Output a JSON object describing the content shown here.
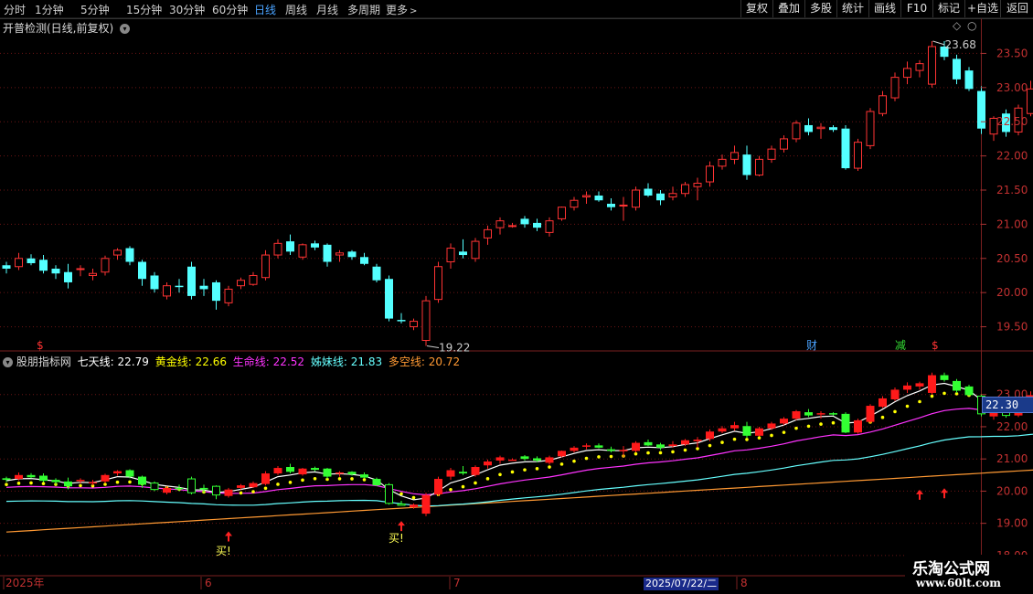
{
  "toolbar": {
    "periods": [
      "分时",
      "1分钟",
      "5分钟",
      "15分钟",
      "30分钟",
      "60分钟",
      "日线",
      "周线",
      "月线",
      "多周期",
      "更多"
    ],
    "active_period": "日线",
    "more_chevron_icon": "chevron-right-icon",
    "right_buttons": [
      "复权",
      "叠加",
      "多股",
      "统计",
      "画线",
      "F10",
      "标记",
      "+自选",
      "返回"
    ]
  },
  "main_panel": {
    "title": "开普检测(日线,前复权)",
    "dropdown_icon": "chevron-down-circle-icon",
    "corner_icon": "diamond-icon",
    "marks": {
      "s1": "$",
      "cai": "财",
      "jian": "减",
      "s2": "$"
    }
  },
  "indicator_panel": {
    "name": "股朋指标网",
    "lines": [
      {
        "label": "七天线:",
        "value": "22.79",
        "color": "#ffffff"
      },
      {
        "label": "黄金线:",
        "value": "22.66",
        "color": "#ffff00"
      },
      {
        "label": "生命线:",
        "value": "22.52",
        "color": "#ff33ff"
      },
      {
        "label": "姊妹线:",
        "value": "21.83",
        "color": "#66ffff"
      },
      {
        "label": "多空线:",
        "value": "20.72",
        "color": "#ff9933"
      }
    ],
    "buy_label": "买!",
    "current_value": "22.30"
  },
  "x_axis": {
    "labels": [
      "2025年",
      "6",
      "7",
      "8"
    ],
    "cursor_date": "2025/07/22/二"
  },
  "watermark": {
    "title": "乐淘公式网",
    "url": "www.60lt.com"
  },
  "chart_data": [
    {
      "type": "candlestick",
      "title": "开普检测(日线,前复权)",
      "ylim": [
        19.2,
        23.8
      ],
      "yticks": [
        19.5,
        20.0,
        20.5,
        21.0,
        21.5,
        22.0,
        22.5,
        23.0,
        23.5
      ],
      "annotations": {
        "high": "23.68",
        "low": "19.22"
      },
      "ohlc": [
        [
          20.4,
          20.45,
          20.28,
          20.35
        ],
        [
          20.38,
          20.58,
          20.33,
          20.5
        ],
        [
          20.5,
          20.56,
          20.4,
          20.43
        ],
        [
          20.48,
          20.55,
          20.28,
          20.32
        ],
        [
          20.35,
          20.4,
          20.2,
          20.28
        ],
        [
          20.3,
          20.42,
          20.06,
          20.15
        ],
        [
          20.35,
          20.4,
          20.24,
          20.35
        ],
        [
          20.25,
          20.35,
          20.18,
          20.28
        ],
        [
          20.3,
          20.54,
          20.25,
          20.5
        ],
        [
          20.55,
          20.65,
          20.48,
          20.62
        ],
        [
          20.65,
          20.68,
          20.4,
          20.45
        ],
        [
          20.45,
          20.48,
          20.1,
          20.2
        ],
        [
          20.25,
          20.3,
          20.0,
          20.05
        ],
        [
          19.95,
          20.15,
          19.9,
          20.1
        ],
        [
          20.1,
          20.2,
          20.0,
          20.08
        ],
        [
          20.38,
          20.45,
          19.9,
          19.95
        ],
        [
          20.1,
          20.2,
          19.95,
          20.05
        ],
        [
          20.15,
          20.18,
          19.75,
          19.88
        ],
        [
          19.85,
          20.1,
          19.8,
          20.05
        ],
        [
          20.1,
          20.22,
          20.05,
          20.18
        ],
        [
          20.12,
          20.3,
          20.1,
          20.25
        ],
        [
          20.22,
          20.62,
          20.18,
          20.55
        ],
        [
          20.55,
          20.78,
          20.5,
          20.72
        ],
        [
          20.75,
          20.85,
          20.55,
          20.6
        ],
        [
          20.52,
          20.72,
          20.48,
          20.7
        ],
        [
          20.72,
          20.76,
          20.62,
          20.66
        ],
        [
          20.7,
          20.72,
          20.38,
          20.45
        ],
        [
          20.55,
          20.62,
          20.45,
          20.58
        ],
        [
          20.6,
          20.62,
          20.48,
          20.52
        ],
        [
          20.52,
          20.58,
          20.4,
          20.42
        ],
        [
          20.38,
          20.42,
          20.15,
          20.18
        ],
        [
          20.2,
          20.25,
          19.58,
          19.62
        ],
        [
          19.6,
          19.7,
          19.55,
          19.58
        ],
        [
          19.5,
          19.62,
          19.45,
          19.58
        ],
        [
          19.3,
          19.95,
          19.22,
          19.88
        ],
        [
          19.9,
          20.45,
          19.85,
          20.38
        ],
        [
          20.45,
          20.72,
          20.35,
          20.65
        ],
        [
          20.6,
          20.78,
          20.5,
          20.55
        ],
        [
          20.5,
          20.8,
          20.45,
          20.75
        ],
        [
          20.8,
          20.98,
          20.7,
          20.92
        ],
        [
          20.95,
          21.1,
          20.85,
          21.05
        ],
        [
          20.98,
          21.02,
          20.95,
          20.98
        ],
        [
          21.08,
          21.12,
          20.95,
          21.0
        ],
        [
          21.02,
          21.08,
          20.9,
          20.95
        ],
        [
          20.88,
          21.1,
          20.82,
          21.05
        ],
        [
          21.08,
          21.26,
          21.05,
          21.25
        ],
        [
          21.25,
          21.4,
          21.2,
          21.35
        ],
        [
          21.4,
          21.48,
          21.3,
          21.42
        ],
        [
          21.42,
          21.48,
          21.33,
          21.35
        ],
        [
          21.3,
          21.38,
          21.2,
          21.25
        ],
        [
          21.28,
          21.4,
          21.05,
          21.28
        ],
        [
          21.25,
          21.55,
          21.2,
          21.5
        ],
        [
          21.52,
          21.6,
          21.4,
          21.42
        ],
        [
          21.45,
          21.5,
          21.28,
          21.35
        ],
        [
          21.4,
          21.55,
          21.35,
          21.45
        ],
        [
          21.45,
          21.62,
          21.4,
          21.58
        ],
        [
          21.55,
          21.68,
          21.35,
          21.6
        ],
        [
          21.62,
          21.92,
          21.55,
          21.85
        ],
        [
          21.85,
          22.02,
          21.8,
          21.95
        ],
        [
          21.95,
          22.15,
          21.88,
          22.05
        ],
        [
          22.02,
          22.15,
          21.65,
          21.72
        ],
        [
          21.72,
          22.0,
          21.7,
          21.95
        ],
        [
          21.95,
          22.15,
          21.9,
          22.1
        ],
        [
          22.1,
          22.3,
          22.05,
          22.25
        ],
        [
          22.25,
          22.52,
          22.2,
          22.48
        ],
        [
          22.45,
          22.55,
          22.3,
          22.35
        ],
        [
          22.4,
          22.48,
          22.25,
          22.42
        ],
        [
          22.42,
          22.45,
          22.35,
          22.38
        ],
        [
          22.4,
          22.45,
          21.8,
          21.82
        ],
        [
          21.82,
          22.25,
          21.78,
          22.2
        ],
        [
          22.15,
          22.7,
          22.1,
          22.65
        ],
        [
          22.62,
          22.95,
          22.58,
          22.88
        ],
        [
          22.85,
          23.22,
          22.8,
          23.15
        ],
        [
          23.15,
          23.38,
          23.05,
          23.28
        ],
        [
          23.25,
          23.4,
          23.15,
          23.35
        ],
        [
          23.05,
          23.68,
          23.0,
          23.6
        ],
        [
          23.6,
          23.68,
          23.4,
          23.45
        ],
        [
          23.42,
          23.48,
          23.05,
          23.12
        ],
        [
          23.25,
          23.3,
          22.95,
          22.98
        ],
        [
          22.95,
          23.02,
          22.32,
          22.4
        ],
        [
          22.32,
          22.58,
          22.22,
          22.55
        ],
        [
          22.62,
          22.68,
          22.28,
          22.35
        ],
        [
          22.35,
          22.75,
          22.3,
          22.7
        ],
        [
          22.62,
          23.1,
          22.58,
          22.98
        ],
        [
          22.98,
          23.12,
          22.92,
          22.95
        ],
        [
          22.8,
          22.9,
          22.42,
          22.55
        ],
        [
          22.95,
          22.98,
          22.92,
          22.95
        ]
      ]
    },
    {
      "type": "line",
      "title": "股朋指标网",
      "ylim": [
        17.6,
        23.9
      ],
      "yticks": [
        18.0,
        19.0,
        20.0,
        21.0,
        22.0,
        23.0
      ],
      "series": [
        {
          "name": "七天线",
          "last": 22.79
        },
        {
          "name": "黄金线",
          "last": 22.66
        },
        {
          "name": "生命线",
          "last": 22.52
        },
        {
          "name": "姊妹线",
          "last": 21.83
        },
        {
          "name": "多空线",
          "last": 20.72
        }
      ]
    }
  ]
}
